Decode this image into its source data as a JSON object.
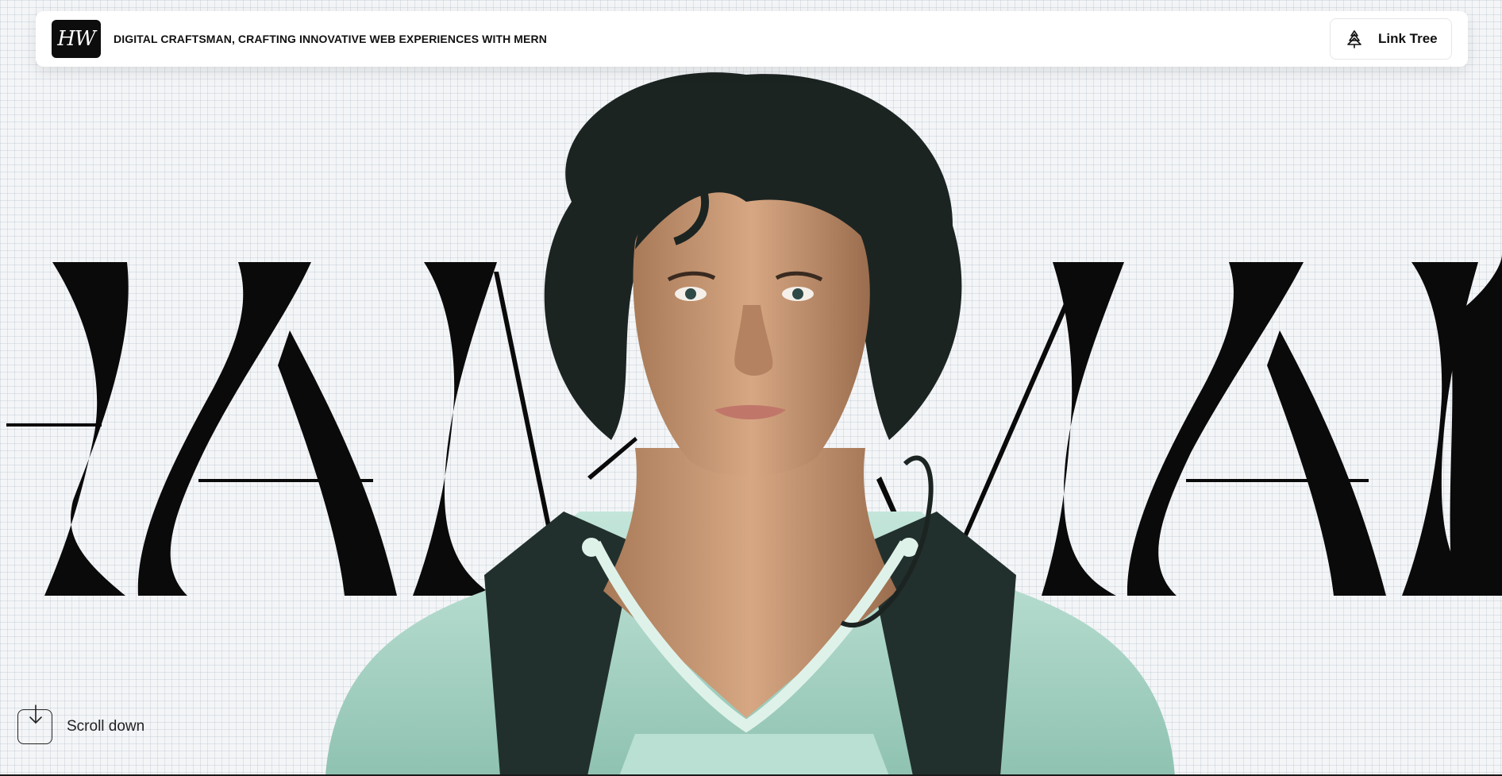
{
  "header": {
    "logo_text": "HW",
    "tagline": "DIGITAL CRAFTSMAN, CRAFTING INNOVATIVE WEB EXPERIENCES WITH MERN",
    "link_tree_label": "Link Tree",
    "link_tree_icon": "tree-icon"
  },
  "hero": {
    "portrait_icon": "astronaut-portrait-illustration"
  },
  "scroll": {
    "label": "Scroll down",
    "icon": "arrow-down-icon"
  },
  "colors": {
    "background": "#f3f5f7",
    "ink": "#0a0a0a",
    "suit": "#a9d7c8",
    "skin": "#c99a74",
    "hair": "#1c2422"
  }
}
